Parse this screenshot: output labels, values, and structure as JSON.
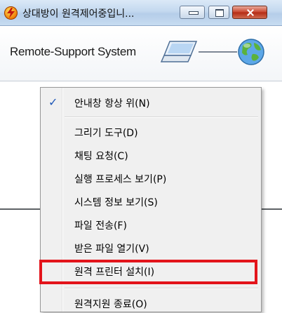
{
  "window": {
    "title": "상대방이 원격제어중입니...",
    "buttons": {
      "minimize": "minimize",
      "maximize": "maximize",
      "close": "close"
    }
  },
  "header": {
    "brand": "Remote-Support System",
    "icons": [
      "laptop-icon",
      "globe-icon"
    ]
  },
  "menu": {
    "items": [
      {
        "label": "안내창 항상 위(N)",
        "checked": true
      },
      {
        "label": "그리기 도구(D)"
      },
      {
        "label": "채팅 요청(C)"
      },
      {
        "label": "실행 프로세스 보기(P)"
      },
      {
        "label": "시스템 정보 보기(S)"
      },
      {
        "label": "파일 전송(F)"
      },
      {
        "label": "받은 파일 열기(V)"
      },
      {
        "label": "원격 프린터 설치(I)",
        "highlighted": true
      },
      {
        "label": "원격지원 종료(O)"
      }
    ],
    "check_glyph": "✓"
  },
  "colors": {
    "highlight_border": "#e3141b",
    "menu_bg": "#f0f0f0",
    "check": "#1e57b8"
  }
}
